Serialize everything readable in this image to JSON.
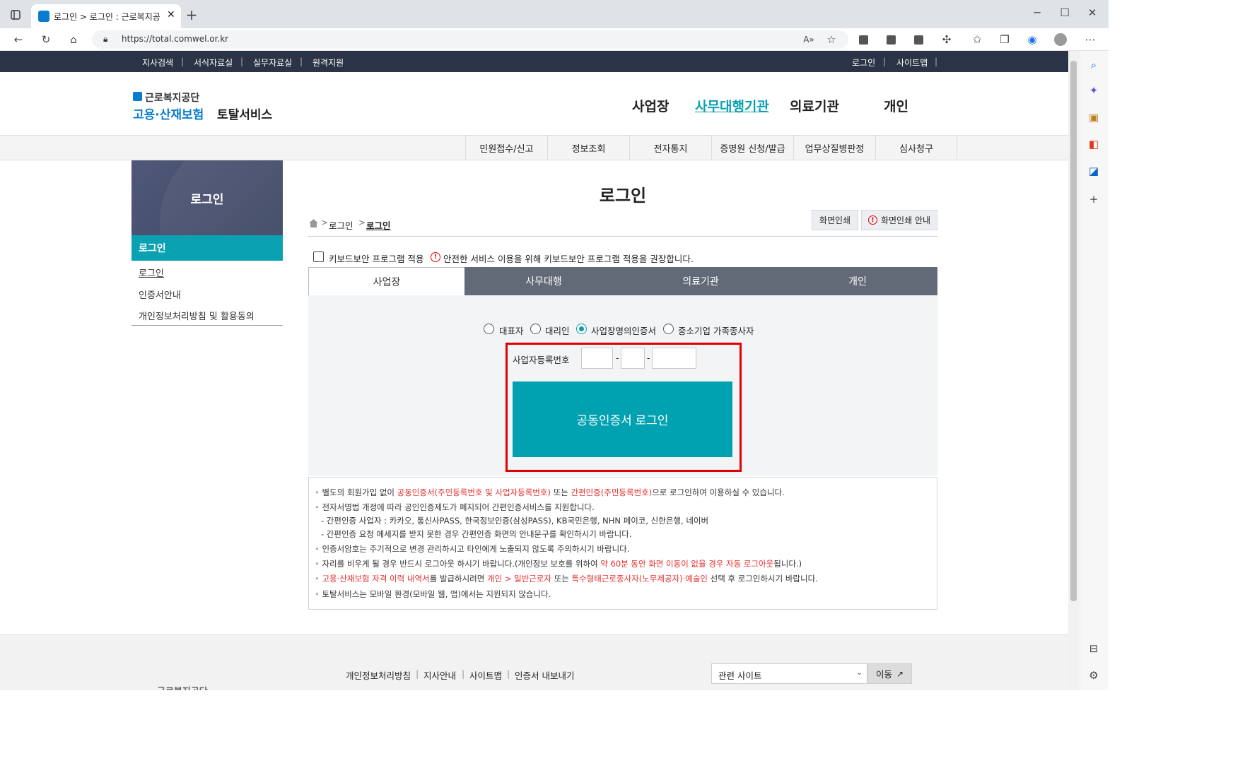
{
  "browser": {
    "tab_title": "로그인 > 로그인 : 근로복지공단 ...",
    "url": "https://total.comwel.or.kr"
  },
  "topbar": {
    "left_links": [
      "지사검색",
      "서식자료실",
      "실무자료실",
      "원격지원"
    ],
    "right_links": [
      "로그인",
      "사이트맵"
    ]
  },
  "header": {
    "logo_top": "근로복지공단",
    "logo_main_a": "고용·산재보험",
    "logo_main_b": "토탈서비스",
    "nav": [
      "사업장",
      "사무대행기관",
      "의료기관",
      "개인"
    ],
    "active_nav": "사무대행기관",
    "active_color": "#0aa1b3"
  },
  "subnav": [
    "민원접수/신고",
    "정보조회",
    "전자통지",
    "증명원 신청/발급",
    "업무상질병판정",
    "심사청구"
  ],
  "sidebar": {
    "title": "로그인",
    "active": "로그인",
    "items": [
      "로그인",
      "인증서안내",
      "개인정보처리방침 및 활용동의"
    ]
  },
  "content": {
    "title": "로그인",
    "breadcrumb": [
      "로그인",
      "로그인"
    ],
    "print_button": "화면인쇄",
    "print_guide_button": "화면인쇄 안내",
    "keyboard_security_label": "키보드보안 프로그램 적용",
    "keyboard_security_note": "안전한 서비스 이용을 위해 키보드보안 프로그램 적용을 권장합니다.",
    "tabs": [
      "사업장",
      "사무대행",
      "의료기관",
      "개인"
    ],
    "active_tab": "사업장",
    "radios": [
      "대표자",
      "대리인",
      "사업장명의인증서",
      "중소기업 가족종사자"
    ],
    "selected_radio": "사업장명의인증서",
    "biz_number_label": "사업자등록번호",
    "dash": "-",
    "login_button": "공동인증서 로그인",
    "accent_color": "#00a2b2",
    "highlight_color": "#e00000"
  },
  "notice": {
    "l1_a": "별도의 회원가입 없이 ",
    "l1_b": "공동인증서(주민등록번호 및 사업자등록번호)",
    "l1_c": " 또는 ",
    "l1_d": "간편인증(주민등록번호)",
    "l1_e": "으로 로그인하여 이용하실 수 있습니다.",
    "l2": "전자서명법 개정에 따라 공인인증제도가 폐지되어 간편인증서비스를 지원합니다.",
    "l3": "- 간편인증 사업자 : 카카오, 통신사PASS, 한국정보인증(삼성PASS), KB국민은행, NHN 페이코, 신한은행, 네이버",
    "l4": "- 간편인증 요청 메세지를 받지 못한 경우 간편인증 화면의 안내문구를 확인하시기 바랍니다.",
    "l5": "인증서암호는 주기적으로 변경 관리하시고 타인에게 노출되지 않도록 주의하시기 바랍니다.",
    "l6_a": "자리를 비우게 될 경우 반드시 로그아웃 하시기 바랍니다.(개인정보 보호를 위하여 ",
    "l6_b": "약 60분 동안 화면 이동이 없을 경우 자동 로그아웃",
    "l6_c": "됩니다.)",
    "l7_a": "고용·산재보험 자격 이력 내역서",
    "l7_b": "를 발급하시려면 ",
    "l7_c": "개인 > 일반근로자",
    "l7_d": " 또는 ",
    "l7_e": "특수형태근로종사자(노무제공자)·예술인",
    "l7_f": " 선택 후 로그인하시기 바랍니다.",
    "l8": "토탈서비스는 모바일 환경(모바일 웹, 앱)에서는 지원되지 않습니다."
  },
  "footer": {
    "links": [
      "개인정보처리방침",
      "지사안내",
      "사이트맵",
      "인증서 내보내기"
    ],
    "related_select": "관련 사이트",
    "go_button": "이동",
    "logo_partial": "근로복지공단"
  }
}
